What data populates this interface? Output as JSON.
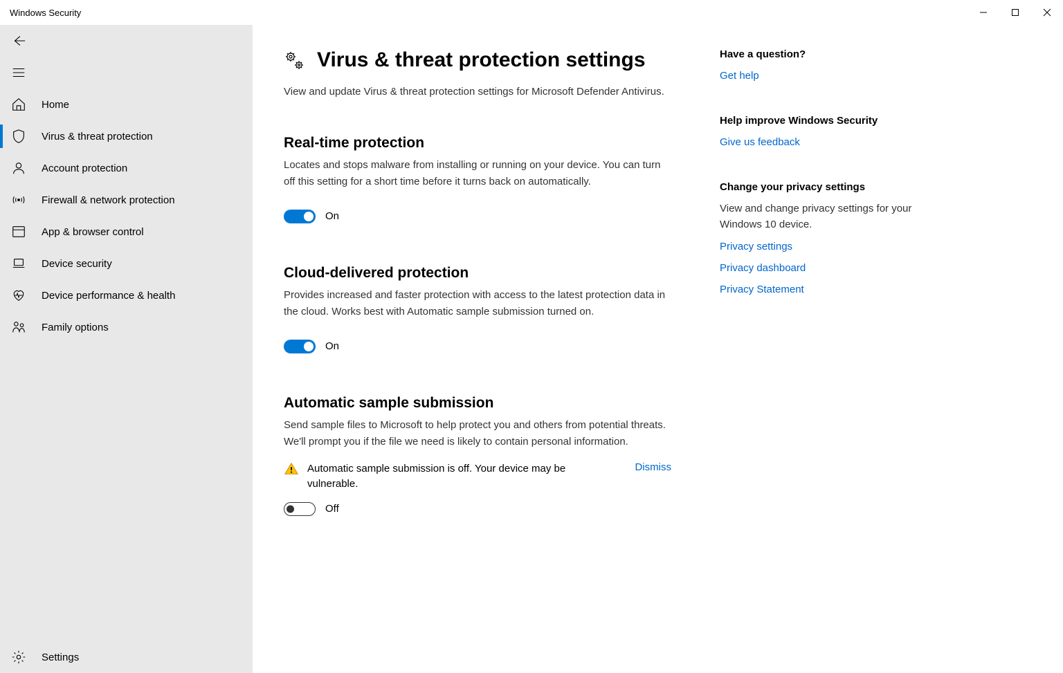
{
  "title": "Windows Security",
  "sidebar": {
    "back": "",
    "items": [
      {
        "label": "Home"
      },
      {
        "label": "Virus & threat protection"
      },
      {
        "label": "Account protection"
      },
      {
        "label": "Firewall & network protection"
      },
      {
        "label": "App & browser control"
      },
      {
        "label": "Device security"
      },
      {
        "label": "Device performance & health"
      },
      {
        "label": "Family options"
      }
    ],
    "settings_label": "Settings"
  },
  "page": {
    "heading": "Virus & threat protection settings",
    "description": "View and update Virus & threat protection settings for Microsoft Defender Antivirus."
  },
  "sections": {
    "realtime": {
      "title": "Real-time protection",
      "desc": "Locates and stops malware from installing or running on your device. You can turn off this setting for a short time before it turns back on automatically.",
      "state": "On"
    },
    "cloud": {
      "title": "Cloud-delivered protection",
      "desc": "Provides increased and faster protection with access to the latest protection data in the cloud. Works best with Automatic sample submission turned on.",
      "state": "On"
    },
    "sample": {
      "title": "Automatic sample submission",
      "desc": "Send sample files to Microsoft to help protect you and others from potential threats. We'll prompt you if the file we need is likely to contain personal information.",
      "warning": "Automatic sample submission is off. Your device may be vulnerable.",
      "dismiss": "Dismiss",
      "state": "Off"
    }
  },
  "right": {
    "question": {
      "title": "Have a question?",
      "link": "Get help"
    },
    "improve": {
      "title": "Help improve Windows Security",
      "link": "Give us feedback"
    },
    "privacy": {
      "title": "Change your privacy settings",
      "desc": "View and change privacy settings for your Windows 10 device.",
      "links": [
        "Privacy settings",
        "Privacy dashboard",
        "Privacy Statement"
      ]
    }
  }
}
